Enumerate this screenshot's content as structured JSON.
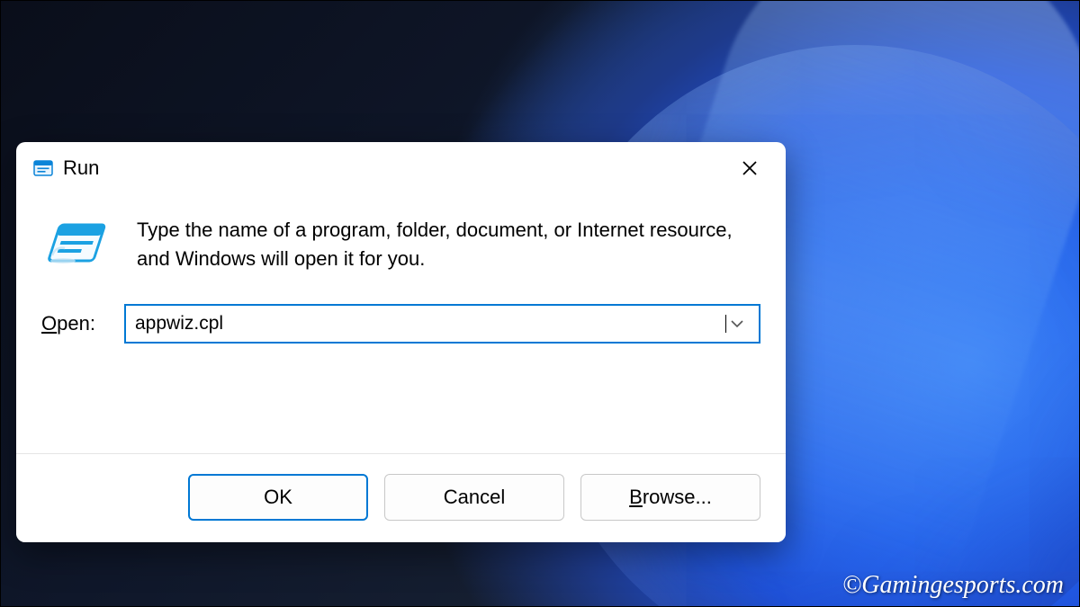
{
  "dialog": {
    "title": "Run",
    "description": "Type the name of a program, folder, document, or Internet resource, and Windows will open it for you.",
    "open_label_prefix": "O",
    "open_label_rest": "pen:",
    "input_value": "appwiz.cpl",
    "buttons": {
      "ok": "OK",
      "cancel": "Cancel",
      "browse_prefix": "B",
      "browse_rest": "rowse..."
    }
  },
  "watermark": "©Gamingesports.com"
}
